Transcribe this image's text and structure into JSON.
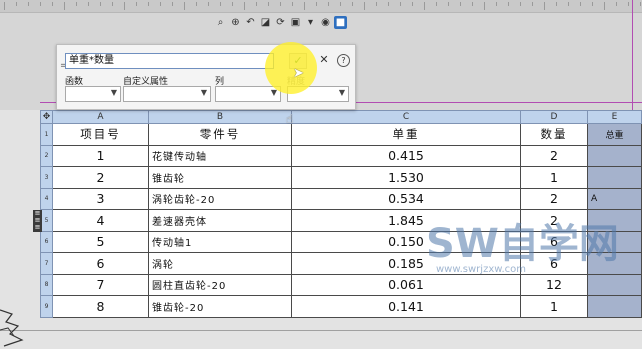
{
  "formula_bar": {
    "prefix": "=",
    "formula": "单重*数量",
    "labels": [
      "函数",
      "自定义属性",
      "列",
      "精度"
    ]
  },
  "table": {
    "columns": [
      "A",
      "B",
      "C",
      "D",
      "E"
    ],
    "row_numbers": [
      "1",
      "2",
      "3",
      "4",
      "5",
      "6",
      "7",
      "8",
      "9"
    ],
    "headers": {
      "a": "项目号",
      "b": "零件号",
      "c": "单重",
      "d": "数量",
      "e": "总重"
    },
    "rows": [
      {
        "n": "1",
        "name": "花键传动轴",
        "weight": "0.415",
        "qty": "2"
      },
      {
        "n": "2",
        "name": "锥齿轮",
        "weight": "1.530",
        "qty": "1"
      },
      {
        "n": "3",
        "name": "涡轮齿轮-20",
        "weight": "0.534",
        "qty": "2"
      },
      {
        "n": "4",
        "name": "差速器壳体",
        "weight": "1.845",
        "qty": "2"
      },
      {
        "n": "5",
        "name": "传动轴1",
        "weight": "0.150",
        "qty": "6"
      },
      {
        "n": "6",
        "name": "涡轮",
        "weight": "0.185",
        "qty": "6"
      },
      {
        "n": "7",
        "name": "圆柱直齿轮-20",
        "weight": "0.061",
        "qty": "12"
      },
      {
        "n": "8",
        "name": "锥齿轮-20",
        "weight": "0.141",
        "qty": "1"
      }
    ],
    "e_mark": "A"
  },
  "watermark": {
    "big": "SW自学网",
    "small": "www.swrjzxw.com"
  },
  "colors": {
    "highlight": "#fff028",
    "header_blue": "#bfd3ec",
    "selection_pink": "#b24db2"
  },
  "icons": [
    "zoom-fit-icon",
    "zoom-area-icon",
    "previous-view-icon",
    "section-view-icon",
    "rotate-icon",
    "display-style-icon",
    "hide-show-icon",
    "appearance-icon",
    "scene-icon"
  ]
}
